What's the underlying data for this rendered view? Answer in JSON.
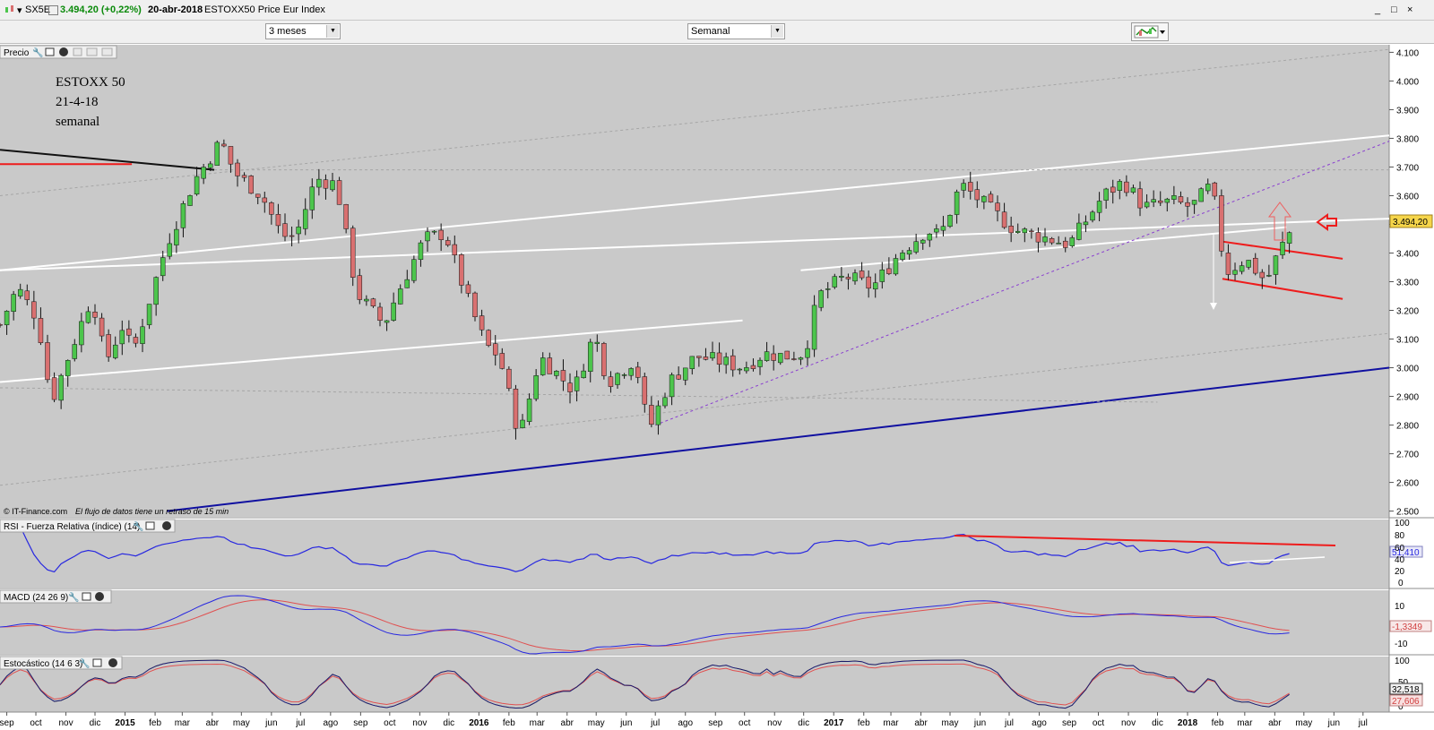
{
  "window": {
    "menu_glyph": "▾",
    "ticker": "SX5E",
    "price_change": "3.494,20 (+0,22%)",
    "date": "20-abr-2018",
    "index_name": "ESTOXX50 Price Eur Index",
    "controls": [
      "_",
      "□",
      "×"
    ]
  },
  "toolbar": {
    "period_select": "3 meses",
    "interval_select": "Semanal",
    "chart_type_icon": "candlestick-chart-icon"
  },
  "colors": {
    "panel_bg": "#c9c9c9",
    "up_candle": "#4cc54c",
    "down_candle": "#d97070",
    "white_channel": "#ffffff",
    "trend_blue": "#1010a0",
    "red_line": "#ee1c1c",
    "purple_dotted": "#8a3fd0",
    "rsi_line": "#2828e0",
    "macd_signal": "#e05050"
  },
  "price_panel": {
    "label": "Precio",
    "annotation": [
      "ESTOXX 50",
      "21-4-18",
      "semanal"
    ],
    "copyright": "© IT-Finance.com",
    "disclaimer": "El flujo de datos tiene un retraso de 15 min",
    "last_price_tag": "3.494,20",
    "arrow_icon": "left-arrow-icon"
  },
  "rsi_panel": {
    "label": "RSI - Fuerza Relativa (índice) (14)",
    "value_tag": "51,410",
    "ticks": [
      "100",
      "80",
      "60",
      "40",
      "20",
      "0"
    ]
  },
  "macd_panel": {
    "label": "MACD (24 26 9)",
    "value_tag": "-1,3349",
    "ticks": [
      "10",
      "-10"
    ]
  },
  "stoch_panel": {
    "label": "Estocástico (14 6 3)",
    "value_tags": [
      "32,518",
      "27,606"
    ],
    "ticks": [
      "100",
      "50",
      "0"
    ]
  },
  "chart_data": {
    "type": "candlestick",
    "title": "ESTOXX50 Price Eur Index",
    "interval": "weekly",
    "y_axis_labels": [
      "4.100",
      "4.000",
      "3.900",
      "3.800",
      "3.700",
      "3.600",
      "3.500",
      "3.400",
      "3.300",
      "3.200",
      "3.100",
      "3.000",
      "2.900",
      "2.800",
      "2.700",
      "2.600",
      "2.500"
    ],
    "ylim": [
      2480,
      4120
    ],
    "xlim": [
      "2014-08-25",
      "2018-07-28"
    ],
    "x_axis_labels": [
      {
        "date": "2014-09-01",
        "label": "sep"
      },
      {
        "date": "2014-10-01",
        "label": "oct"
      },
      {
        "date": "2014-11-01",
        "label": "nov"
      },
      {
        "date": "2014-12-01",
        "label": "dic"
      },
      {
        "date": "2015-01-01",
        "label": "2015"
      },
      {
        "date": "2015-02-01",
        "label": "feb"
      },
      {
        "date": "2015-03-01",
        "label": "mar"
      },
      {
        "date": "2015-04-01",
        "label": "abr"
      },
      {
        "date": "2015-05-01",
        "label": "may"
      },
      {
        "date": "2015-06-01",
        "label": "jun"
      },
      {
        "date": "2015-07-01",
        "label": "jul"
      },
      {
        "date": "2015-08-01",
        "label": "ago"
      },
      {
        "date": "2015-09-01",
        "label": "sep"
      },
      {
        "date": "2015-10-01",
        "label": "oct"
      },
      {
        "date": "2015-11-01",
        "label": "nov"
      },
      {
        "date": "2015-12-01",
        "label": "dic"
      },
      {
        "date": "2016-01-01",
        "label": "2016"
      },
      {
        "date": "2016-02-01",
        "label": "feb"
      },
      {
        "date": "2016-03-01",
        "label": "mar"
      },
      {
        "date": "2016-04-01",
        "label": "abr"
      },
      {
        "date": "2016-05-01",
        "label": "may"
      },
      {
        "date": "2016-06-01",
        "label": "jun"
      },
      {
        "date": "2016-07-01",
        "label": "jul"
      },
      {
        "date": "2016-08-01",
        "label": "ago"
      },
      {
        "date": "2016-09-01",
        "label": "sep"
      },
      {
        "date": "2016-10-01",
        "label": "oct"
      },
      {
        "date": "2016-11-01",
        "label": "nov"
      },
      {
        "date": "2016-12-01",
        "label": "dic"
      },
      {
        "date": "2017-01-01",
        "label": "2017"
      },
      {
        "date": "2017-02-01",
        "label": "feb"
      },
      {
        "date": "2017-03-01",
        "label": "mar"
      },
      {
        "date": "2017-04-01",
        "label": "abr"
      },
      {
        "date": "2017-05-01",
        "label": "may"
      },
      {
        "date": "2017-06-01",
        "label": "jun"
      },
      {
        "date": "2017-07-01",
        "label": "jul"
      },
      {
        "date": "2017-08-01",
        "label": "ago"
      },
      {
        "date": "2017-09-01",
        "label": "sep"
      },
      {
        "date": "2017-10-01",
        "label": "oct"
      },
      {
        "date": "2017-11-01",
        "label": "nov"
      },
      {
        "date": "2017-12-01",
        "label": "dic"
      },
      {
        "date": "2018-01-01",
        "label": "2018"
      },
      {
        "date": "2018-02-01",
        "label": "feb"
      },
      {
        "date": "2018-03-01",
        "label": "mar"
      },
      {
        "date": "2018-04-01",
        "label": "abr"
      },
      {
        "date": "2018-05-01",
        "label": "may"
      },
      {
        "date": "2018-06-01",
        "label": "jun"
      },
      {
        "date": "2018-07-01",
        "label": "jul"
      }
    ],
    "anchors": [
      {
        "date": "2014-08-25",
        "close": 3150
      },
      {
        "date": "2014-09-12",
        "close": 3280
      },
      {
        "date": "2014-10-03",
        "close": 3170
      },
      {
        "date": "2014-10-17",
        "close": 2880
      },
      {
        "date": "2014-11-07",
        "close": 3070
      },
      {
        "date": "2014-11-28",
        "close": 3250
      },
      {
        "date": "2014-12-12",
        "close": 3020
      },
      {
        "date": "2014-12-30",
        "close": 3150
      },
      {
        "date": "2015-01-09",
        "close": 3050
      },
      {
        "date": "2015-02-13",
        "close": 3430
      },
      {
        "date": "2015-03-13",
        "close": 3650
      },
      {
        "date": "2015-04-10",
        "close": 3790
      },
      {
        "date": "2015-04-24",
        "close": 3680
      },
      {
        "date": "2015-05-22",
        "close": 3600
      },
      {
        "date": "2015-06-12",
        "close": 3460
      },
      {
        "date": "2015-06-26",
        "close": 3460
      },
      {
        "date": "2015-07-17",
        "close": 3660
      },
      {
        "date": "2015-08-07",
        "close": 3640
      },
      {
        "date": "2015-08-28",
        "close": 3260
      },
      {
        "date": "2015-09-25",
        "close": 3150
      },
      {
        "date": "2015-10-09",
        "close": 3260
      },
      {
        "date": "2015-11-06",
        "close": 3450
      },
      {
        "date": "2015-11-27",
        "close": 3470
      },
      {
        "date": "2015-12-18",
        "close": 3260
      },
      {
        "date": "2016-01-08",
        "close": 3080
      },
      {
        "date": "2016-01-22",
        "close": 3040
      },
      {
        "date": "2016-02-12",
        "close": 2760
      },
      {
        "date": "2016-03-04",
        "close": 3040
      },
      {
        "date": "2016-04-08",
        "close": 2920
      },
      {
        "date": "2016-04-29",
        "close": 3120
      },
      {
        "date": "2016-05-13",
        "close": 2950
      },
      {
        "date": "2016-06-10",
        "close": 3030
      },
      {
        "date": "2016-06-24",
        "close": 2780
      },
      {
        "date": "2016-07-15",
        "close": 2950
      },
      {
        "date": "2016-08-12",
        "close": 3040
      },
      {
        "date": "2016-09-09",
        "close": 3020
      },
      {
        "date": "2016-09-30",
        "close": 3000
      },
      {
        "date": "2016-10-21",
        "close": 3050
      },
      {
        "date": "2016-11-11",
        "close": 3040
      },
      {
        "date": "2016-12-02",
        "close": 3050
      },
      {
        "date": "2016-12-16",
        "close": 3250
      },
      {
        "date": "2017-01-13",
        "close": 3320
      },
      {
        "date": "2017-02-10",
        "close": 3280
      },
      {
        "date": "2017-03-10",
        "close": 3400
      },
      {
        "date": "2017-04-07",
        "close": 3480
      },
      {
        "date": "2017-04-21",
        "close": 3460
      },
      {
        "date": "2017-05-12",
        "close": 3640
      },
      {
        "date": "2017-06-09",
        "close": 3560
      },
      {
        "date": "2017-07-07",
        "close": 3480
      },
      {
        "date": "2017-08-11",
        "close": 3450
      },
      {
        "date": "2017-09-01",
        "close": 3430
      },
      {
        "date": "2017-10-06",
        "close": 3600
      },
      {
        "date": "2017-10-27",
        "close": 3650
      },
      {
        "date": "2017-11-17",
        "close": 3560
      },
      {
        "date": "2017-12-15",
        "close": 3580
      },
      {
        "date": "2018-01-05",
        "close": 3560
      },
      {
        "date": "2018-01-26",
        "close": 3640
      },
      {
        "date": "2018-02-09",
        "close": 3330
      },
      {
        "date": "2018-03-02",
        "close": 3380
      },
      {
        "date": "2018-03-23",
        "close": 3300
      },
      {
        "date": "2018-04-06",
        "close": 3410
      },
      {
        "date": "2018-04-20",
        "close": 3494.2
      }
    ],
    "overlay_lines": [
      {
        "name": "upper-channel-line",
        "color": "white",
        "points": [
          [
            "2014-08-25",
            3340
          ],
          [
            "2018-07-28",
            3810
          ]
        ]
      },
      {
        "name": "middle-channel-line",
        "color": "white",
        "points": [
          [
            "2014-08-25",
            3340
          ],
          [
            "2018-07-28",
            3520
          ]
        ]
      },
      {
        "name": "lower-channel-line",
        "color": "white",
        "points": [
          [
            "2014-08-25",
            2950
          ],
          [
            "2016-09-29",
            3165
          ]
        ]
      },
      {
        "name": "support-2017-line",
        "color": "white",
        "points": [
          [
            "2016-11-28",
            3340
          ],
          [
            "2018-04-13",
            3490
          ]
        ]
      },
      {
        "name": "long-term-trend-line",
        "color": "blue",
        "points": [
          [
            "2015-02-13",
            2500
          ],
          [
            "2018-07-28",
            3000
          ]
        ]
      },
      {
        "name": "dotted-trend-line",
        "color": "purple",
        "points": [
          [
            "2016-07-01",
            2800
          ],
          [
            "2018-07-28",
            3790
          ]
        ]
      },
      {
        "name": "outer-upper-dotted-line",
        "color": "gray",
        "points": [
          [
            "2014-08-25",
            3600
          ],
          [
            "2018-07-28",
            4110
          ]
        ]
      },
      {
        "name": "outer-lower-dotted-line",
        "color": "gray",
        "points": [
          [
            "2014-08-25",
            2590
          ],
          [
            "2018-07-28",
            3120
          ]
        ]
      },
      {
        "name": "descending-resistance-line",
        "color": "black",
        "points": [
          [
            "2014-08-25",
            3760
          ],
          [
            "2015-04-03",
            3690
          ]
        ]
      },
      {
        "name": "red-resistance-2015-line",
        "color": "red",
        "points": [
          [
            "2014-08-25",
            3710
          ],
          [
            "2015-01-08",
            3710
          ]
        ]
      },
      {
        "name": "gray-horizontal-line",
        "color": "gray",
        "points": [
          [
            "2015-04-03",
            3690
          ],
          [
            "2018-07-28",
            3690
          ]
        ]
      },
      {
        "name": "gray-support-line",
        "color": "gray",
        "points": [
          [
            "2014-08-25",
            2930
          ],
          [
            "2017-12-01",
            2880
          ]
        ]
      },
      {
        "name": "red-wedge-lower-line",
        "color": "red",
        "points": [
          [
            "2018-02-06",
            3310
          ],
          [
            "2018-06-10",
            3240
          ]
        ]
      },
      {
        "name": "red-wedge-upper-line",
        "color": "red",
        "points": [
          [
            "2018-02-06",
            3440
          ],
          [
            "2018-06-10",
            3380
          ]
        ]
      }
    ]
  }
}
